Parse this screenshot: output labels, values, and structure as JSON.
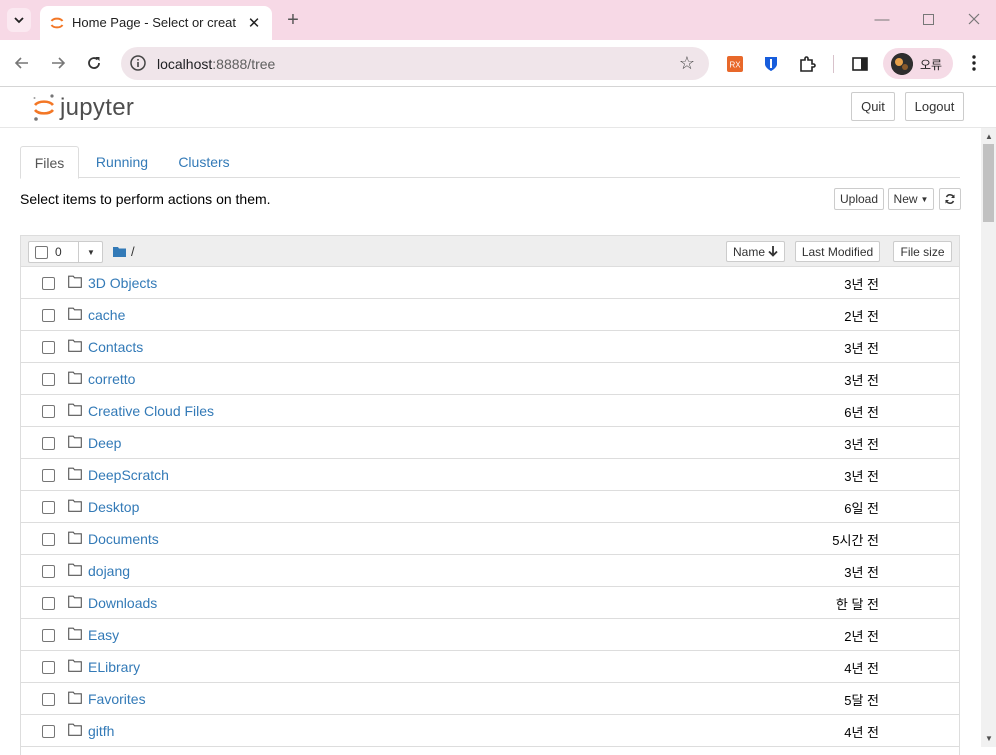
{
  "browser": {
    "tab_title": "Home Page - Select or create",
    "url_host": "localhost",
    "url_rest": ":8888/tree",
    "profile_label": "오류",
    "extensions": [
      "rx-extension-icon",
      "bitwarden-shield-icon",
      "puzzle-extensions-icon"
    ]
  },
  "header": {
    "logo_text": "jupyter",
    "quit_label": "Quit",
    "logout_label": "Logout"
  },
  "tabs": [
    {
      "label": "Files",
      "active": true
    },
    {
      "label": "Running",
      "active": false
    },
    {
      "label": "Clusters",
      "active": false
    }
  ],
  "toolbar": {
    "hint": "Select items to perform actions on them.",
    "upload_label": "Upload",
    "new_label": "New"
  },
  "list_header": {
    "selected_count": "0",
    "breadcrumb_sep": "/",
    "name_label": "Name",
    "last_modified_label": "Last Modified",
    "file_size_label": "File size"
  },
  "rows": [
    {
      "name": "3D Objects",
      "modified": "3년 전"
    },
    {
      "name": "cache",
      "modified": "2년 전"
    },
    {
      "name": "Contacts",
      "modified": "3년 전"
    },
    {
      "name": "corretto",
      "modified": "3년 전"
    },
    {
      "name": "Creative Cloud Files",
      "modified": "6년 전"
    },
    {
      "name": "Deep",
      "modified": "3년 전"
    },
    {
      "name": "DeepScratch",
      "modified": "3년 전"
    },
    {
      "name": "Desktop",
      "modified": "6일 전"
    },
    {
      "name": "Documents",
      "modified": "5시간 전"
    },
    {
      "name": "dojang",
      "modified": "3년 전"
    },
    {
      "name": "Downloads",
      "modified": "한 달 전"
    },
    {
      "name": "Easy",
      "modified": "2년 전"
    },
    {
      "name": "ELibrary",
      "modified": "4년 전"
    },
    {
      "name": "Favorites",
      "modified": "5달 전"
    },
    {
      "name": "gitfh",
      "modified": "4년 전"
    }
  ],
  "colors": {
    "link": "#337ab7",
    "jupyter_orange": "#f37726",
    "tabstrip": "#f7d9e6"
  }
}
